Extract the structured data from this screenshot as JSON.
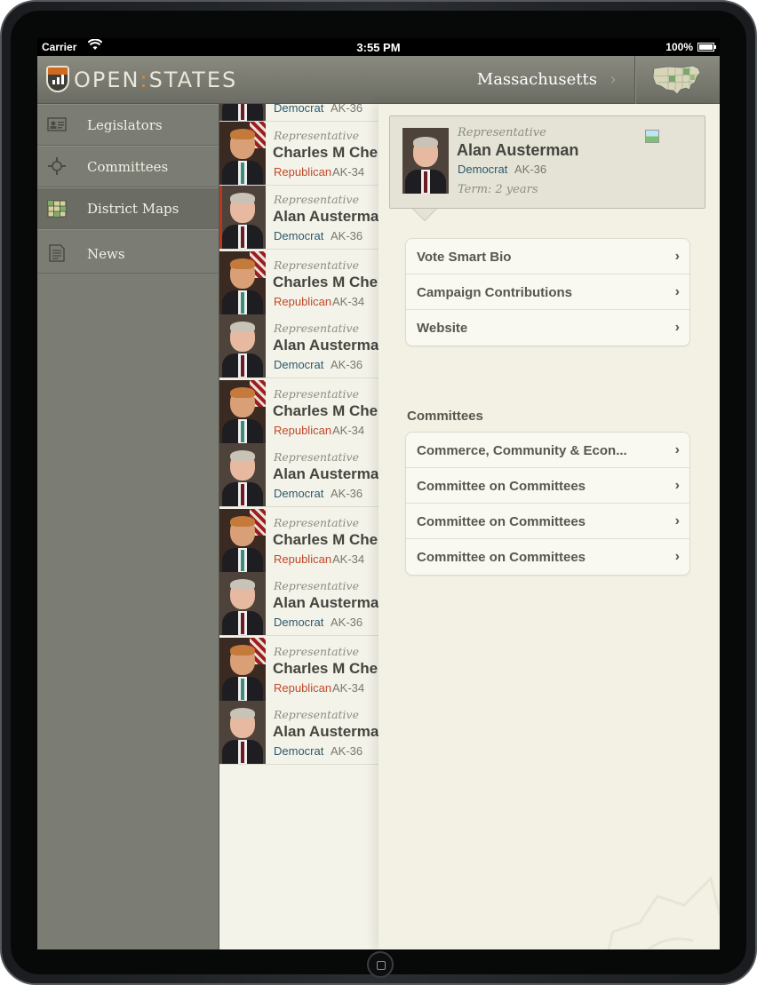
{
  "status_bar": {
    "carrier": "Carrier",
    "time": "3:55 PM",
    "battery": "100%"
  },
  "navbar": {
    "logo_left": "OPEN",
    "logo_sep": ":",
    "logo_right": "STATES",
    "state": "Massachusetts",
    "chevron": "›"
  },
  "sidebar": {
    "items": [
      {
        "label": "Legislators",
        "icon": "id-card-icon"
      },
      {
        "label": "Committees",
        "icon": "committee-icon"
      },
      {
        "label": "District Maps",
        "icon": "map-grid-icon"
      },
      {
        "label": "News",
        "icon": "news-icon"
      }
    ],
    "active_index": 2
  },
  "list": {
    "top_partial": {
      "party": "Democrat",
      "district": "AK-36"
    },
    "rows": [
      {
        "role": "Representative",
        "name": "Charles M Chenoweth",
        "party": "Republican",
        "district": "AK-34"
      },
      {
        "role": "Representative",
        "name": "Alan Austerman",
        "party": "Democrat",
        "district": "AK-36"
      },
      {
        "role": "Representative",
        "name": "Charles M Chenoweth",
        "party": "Republican",
        "district": "AK-34"
      },
      {
        "role": "Representative",
        "name": "Alan Austerman",
        "party": "Democrat",
        "district": "AK-36"
      },
      {
        "role": "Representative",
        "name": "Charles M Chenoweth",
        "party": "Republican",
        "district": "AK-34"
      },
      {
        "role": "Representative",
        "name": "Alan Austerman",
        "party": "Democrat",
        "district": "AK-36"
      },
      {
        "role": "Representative",
        "name": "Charles M Chenoweth",
        "party": "Republican",
        "district": "AK-34"
      },
      {
        "role": "Representative",
        "name": "Alan Austerman",
        "party": "Democrat",
        "district": "AK-36"
      },
      {
        "role": "Representative",
        "name": "Charles M Chenoweth",
        "party": "Republican",
        "district": "AK-34"
      },
      {
        "role": "Representative",
        "name": "Alan Austerman",
        "party": "Democrat",
        "district": "AK-36"
      }
    ]
  },
  "detail": {
    "role": "Representative",
    "name": "Alan Austerman",
    "party": "Democrat",
    "district": "AK-36",
    "term": "Term: 2 years",
    "links": [
      "Vote Smart Bio",
      "Campaign Contributions",
      "Website"
    ],
    "committees_title": "Committees",
    "committees": [
      "Commerce, Community & Econ...",
      "Committee on Committees",
      "Committee on Committees",
      "Committee on Committees"
    ],
    "chevron": "›"
  },
  "colors": {
    "democrat": "#2d5a6c",
    "republican": "#c0482a",
    "accent": "#e0893a",
    "sidebar": "#7b7c73"
  }
}
